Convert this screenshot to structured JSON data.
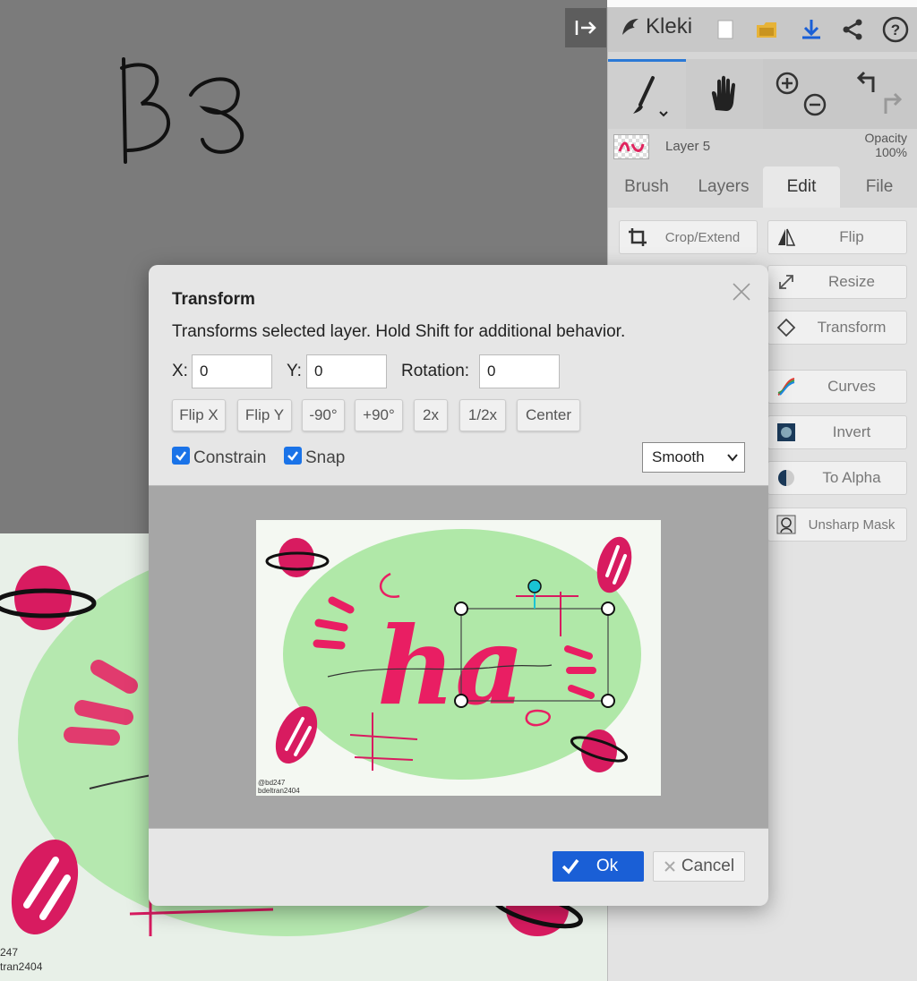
{
  "app": {
    "name": "Kleki"
  },
  "canvas": {
    "signature_line_1": "247",
    "signature_line_2": "tran2404"
  },
  "header_icons": [
    "new-file-icon",
    "open-folder-icon",
    "download-icon",
    "share-icon",
    "help-icon"
  ],
  "toolbar": {
    "tools": [
      "brush-icon",
      "hand-icon",
      "zoom-in-icon",
      "zoom-out-icon",
      "undo-icon",
      "redo-icon"
    ]
  },
  "layer": {
    "name": "Layer 5",
    "opacity_label": "Opacity",
    "opacity_value": "100%"
  },
  "tabs": {
    "brush": "Brush",
    "layers": "Layers",
    "edit": "Edit",
    "file": "File",
    "active": "Edit"
  },
  "edit_panel": {
    "crop": "Crop/Extend",
    "flip": "Flip",
    "resize": "Resize",
    "transform": "Transform",
    "curves": "Curves",
    "invert": "Invert",
    "to_alpha": "To Alpha",
    "unsharp_mask": "Unsharp Mask"
  },
  "dialog": {
    "title": "Transform",
    "description": "Transforms selected layer. Hold Shift for additional behavior.",
    "x_label": "X:",
    "x_value": "0",
    "y_label": "Y:",
    "y_value": "0",
    "rotation_label": "Rotation:",
    "rotation_value": "0",
    "buttons": {
      "flip_x": "Flip X",
      "flip_y": "Flip Y",
      "rot_minus_90": "-90°",
      "rot_plus_90": "+90°",
      "scale_2x": "2x",
      "scale_half": "1/2x",
      "center": "Center"
    },
    "constrain_label": "Constrain",
    "constrain_checked": true,
    "snap_label": "Snap",
    "snap_checked": true,
    "quality_selected": "Smooth",
    "preview_signature_1": "@bd247",
    "preview_signature_2": "bdeltran2404",
    "ok_label": "Ok",
    "cancel_label": "Cancel"
  },
  "colors": {
    "accent": "#1a5fd6",
    "checkbox": "#1a73e8",
    "pink": "#e0245e",
    "green_wash": "#a8e6a0"
  }
}
